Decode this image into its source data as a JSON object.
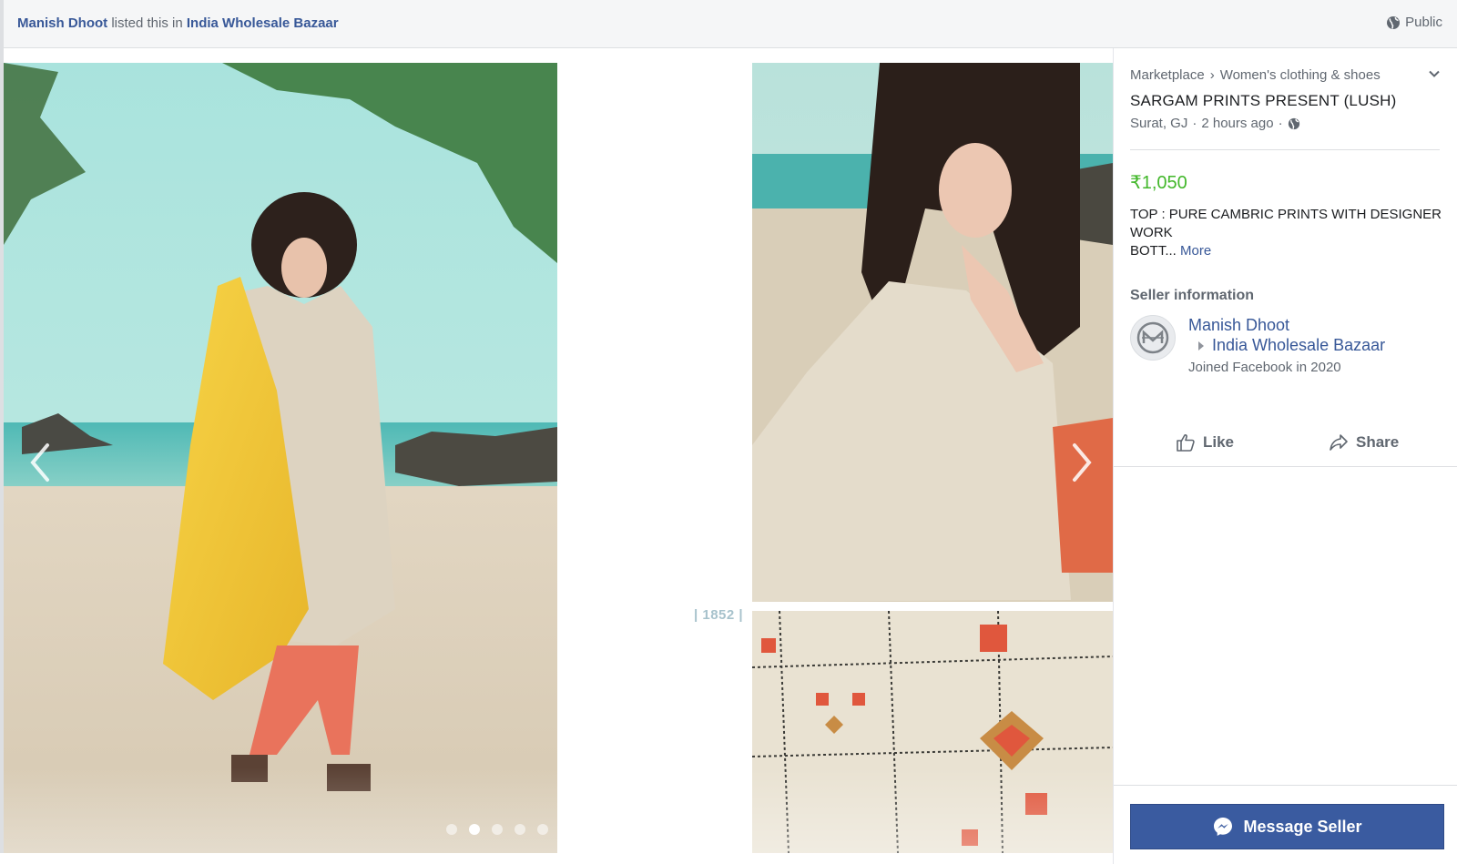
{
  "header": {
    "poster_name": "Manish Dhoot",
    "listed_text": " listed this in ",
    "group_name": "India Wholesale Bazaar",
    "privacy_label": "Public",
    "privacy_icon": "globe-icon"
  },
  "gallery": {
    "code_label": "| 1852 |",
    "prev_icon": "chevron-left-icon",
    "next_icon": "chevron-right-icon",
    "dots_total": 5,
    "active_dot": 2
  },
  "listing": {
    "breadcrumb": [
      "Marketplace",
      "›",
      "Women's clothing & shoes"
    ],
    "title": "SARGAM PRINTS PRESENT (LUSH)",
    "location": "Surat, GJ",
    "separator": "·",
    "time_ago": "2 hours ago",
    "price": "₹1,050",
    "price_color": "#42b72a",
    "description_line1": "TOP : PURE CAMBRIC PRINTS WITH DESIGNER WORK",
    "description_line2": "BOTT...",
    "more_label": "More"
  },
  "seller": {
    "heading": "Seller information",
    "name": "Manish Dhoot",
    "group": "India Wholesale Bazaar",
    "joined": "Joined Facebook in 2020"
  },
  "actions": {
    "like_label": "Like",
    "share_label": "Share",
    "message_label": "Message Seller",
    "message_color": "#3a5ba0"
  }
}
